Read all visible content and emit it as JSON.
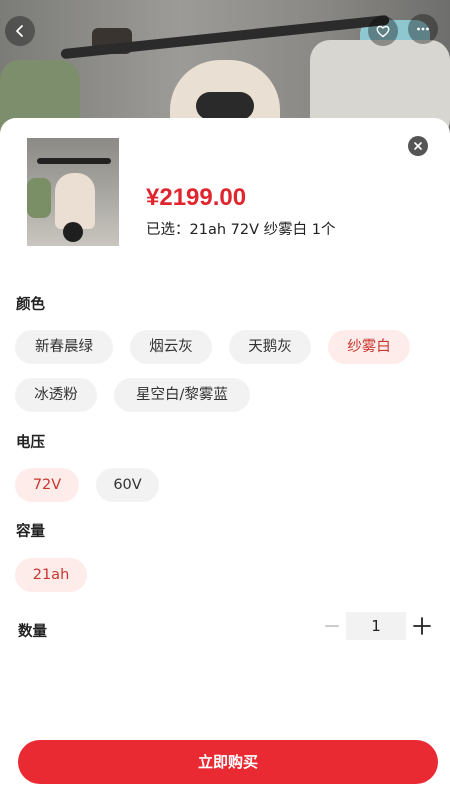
{
  "product": {
    "price": "¥2199.00",
    "selected_summary": "已选：21ah 72V 纱雾白 1个"
  },
  "sections": {
    "color": {
      "title": "颜色",
      "options": [
        "新春晨绿",
        "烟云灰",
        "天鹅灰",
        "纱雾白",
        "冰透粉",
        "星空白/黎雾蓝"
      ],
      "selected": "纱雾白"
    },
    "voltage": {
      "title": "电压",
      "options": [
        "72V",
        "60V"
      ],
      "selected": "72V"
    },
    "capacity": {
      "title": "容量",
      "options": [
        "21ah"
      ],
      "selected": "21ah"
    }
  },
  "quantity": {
    "label": "数量",
    "value": "1"
  },
  "buy_button": "立即购买",
  "colors": {
    "accent": "#ea2a33",
    "price": "#e0252f",
    "chip_active_bg": "#fdecea",
    "chip_active_text": "#c9362f",
    "chip_bg": "#f2f2f2"
  },
  "icons": [
    "back-icon",
    "heart-icon",
    "more-icon",
    "close-icon",
    "minus-icon",
    "plus-icon"
  ]
}
